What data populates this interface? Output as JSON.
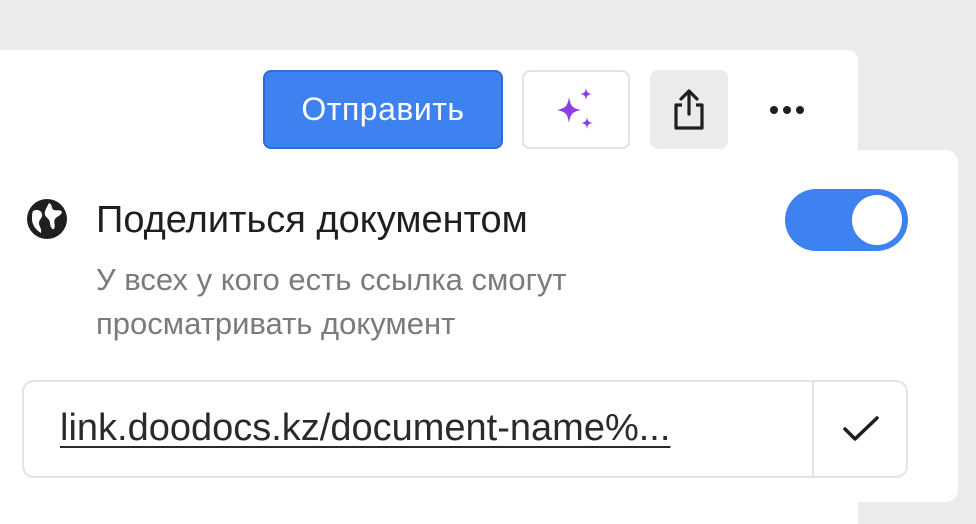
{
  "toolbar": {
    "send_label": "Отправить",
    "ai_icon": "sparkles-icon",
    "share_icon": "share-upload-icon",
    "more_icon": "more-horizontal-icon"
  },
  "share": {
    "icon": "globe-icon",
    "title": "Поделиться документом",
    "description": "У всех у кого есть ссылка смогут просматривать документ",
    "toggle_on": true,
    "link": "link.doodocs.kz/document-name%...",
    "copy_icon": "check-icon"
  },
  "colors": {
    "accent": "#3d82f0",
    "ai_purple": "#8b3fe0",
    "muted_text": "#7b7b7b",
    "background": "#ebebeb"
  }
}
